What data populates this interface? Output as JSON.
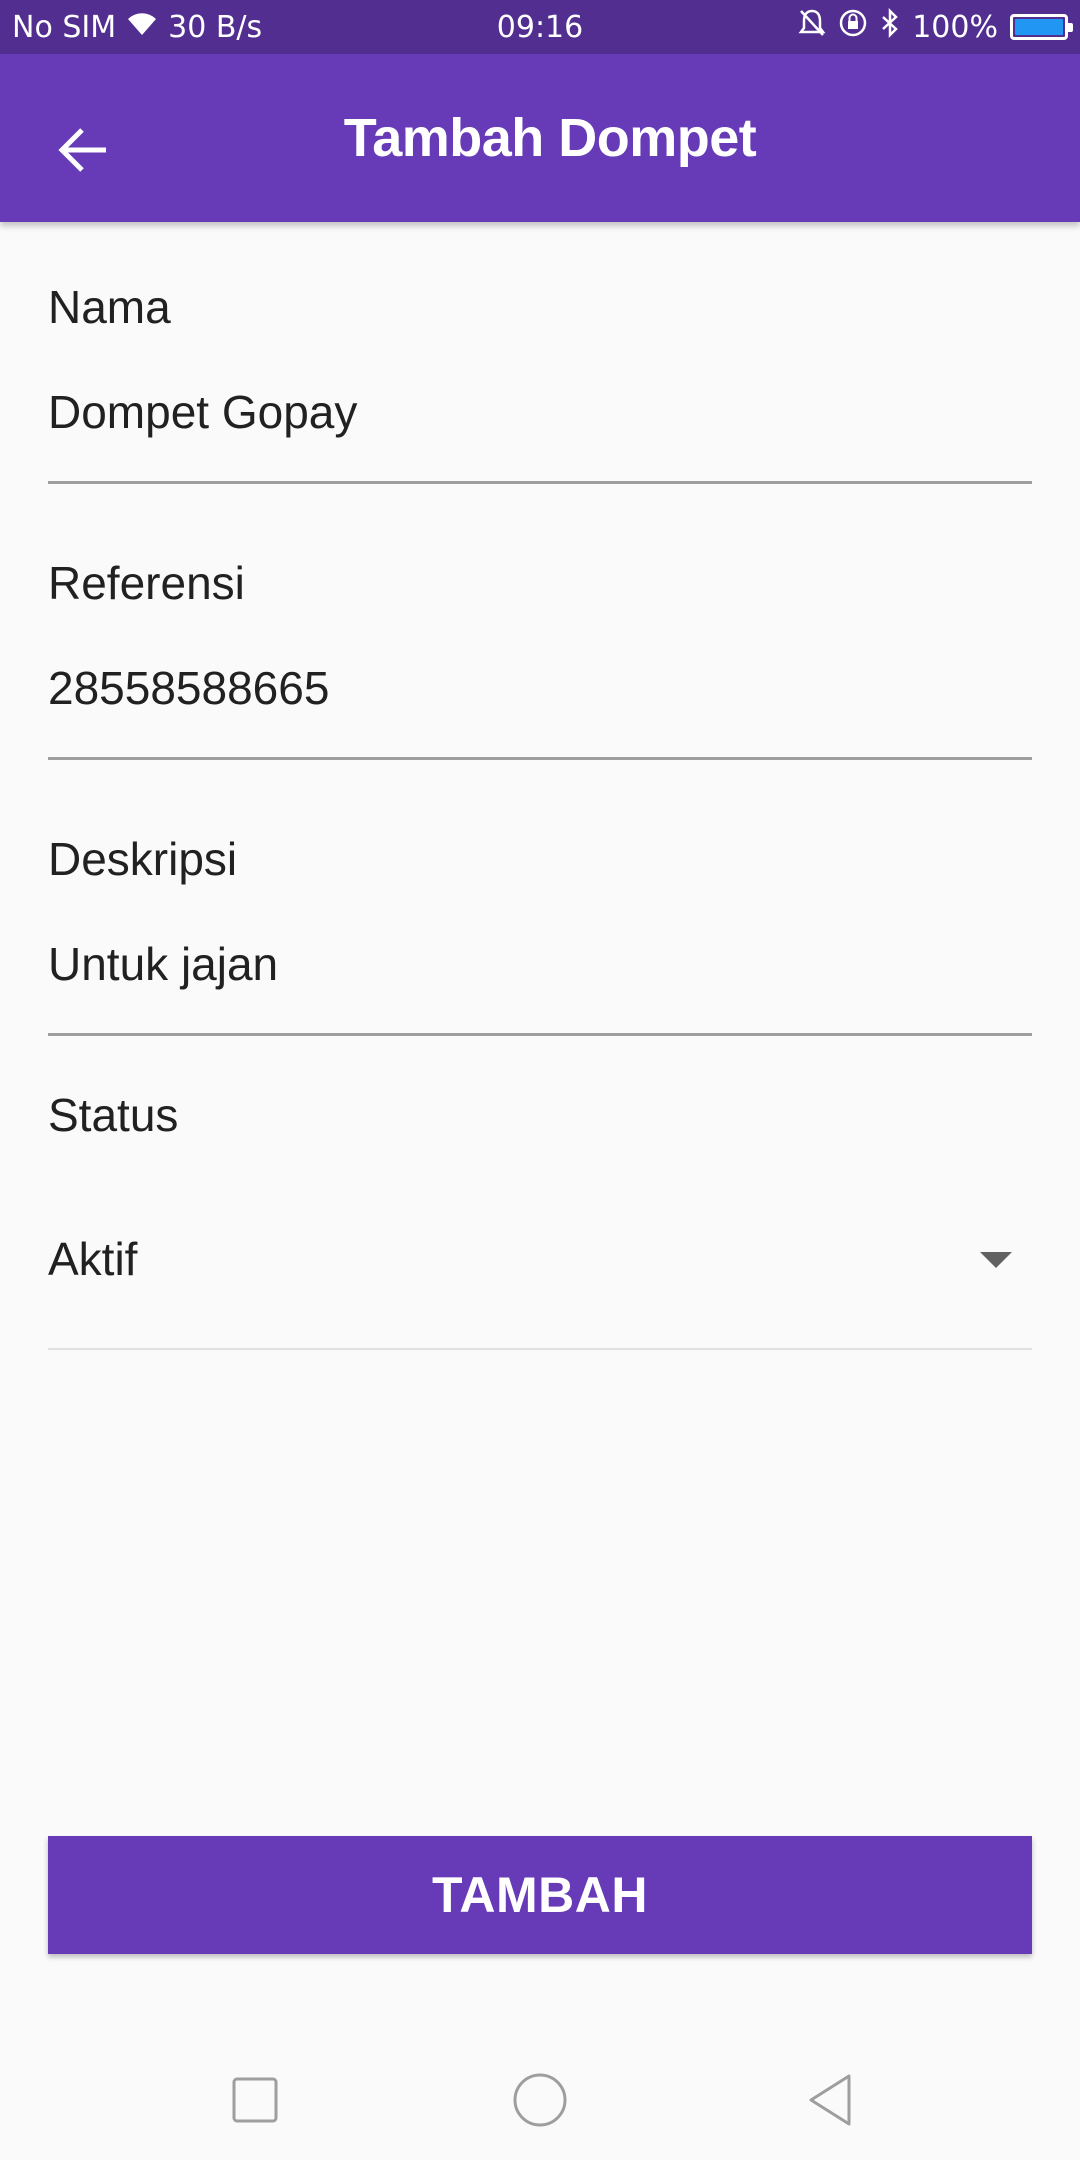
{
  "status_bar": {
    "carrier": "No SIM",
    "speed": "30 B/s",
    "time": "09:16",
    "battery": "100%",
    "battery_level": 1.0
  },
  "app_bar": {
    "title": "Tambah Dompet",
    "back_icon": "arrow-left-icon"
  },
  "form": {
    "nama": {
      "label": "Nama",
      "value": "Dompet Gopay"
    },
    "referensi": {
      "label": "Referensi",
      "value": "28558588665"
    },
    "deskripsi": {
      "label": "Deskripsi",
      "value": "Untuk jajan"
    },
    "status": {
      "label": "Status",
      "value": "Aktif"
    }
  },
  "submit": {
    "label": "TAMBAH"
  },
  "colors": {
    "primary": "#673ab7",
    "status_bar": "#512e90",
    "background": "#fafafa",
    "battery_fill": "#2196f3"
  },
  "nav_bar": {
    "icons": [
      "recent-apps-icon",
      "home-icon",
      "back-icon"
    ]
  }
}
